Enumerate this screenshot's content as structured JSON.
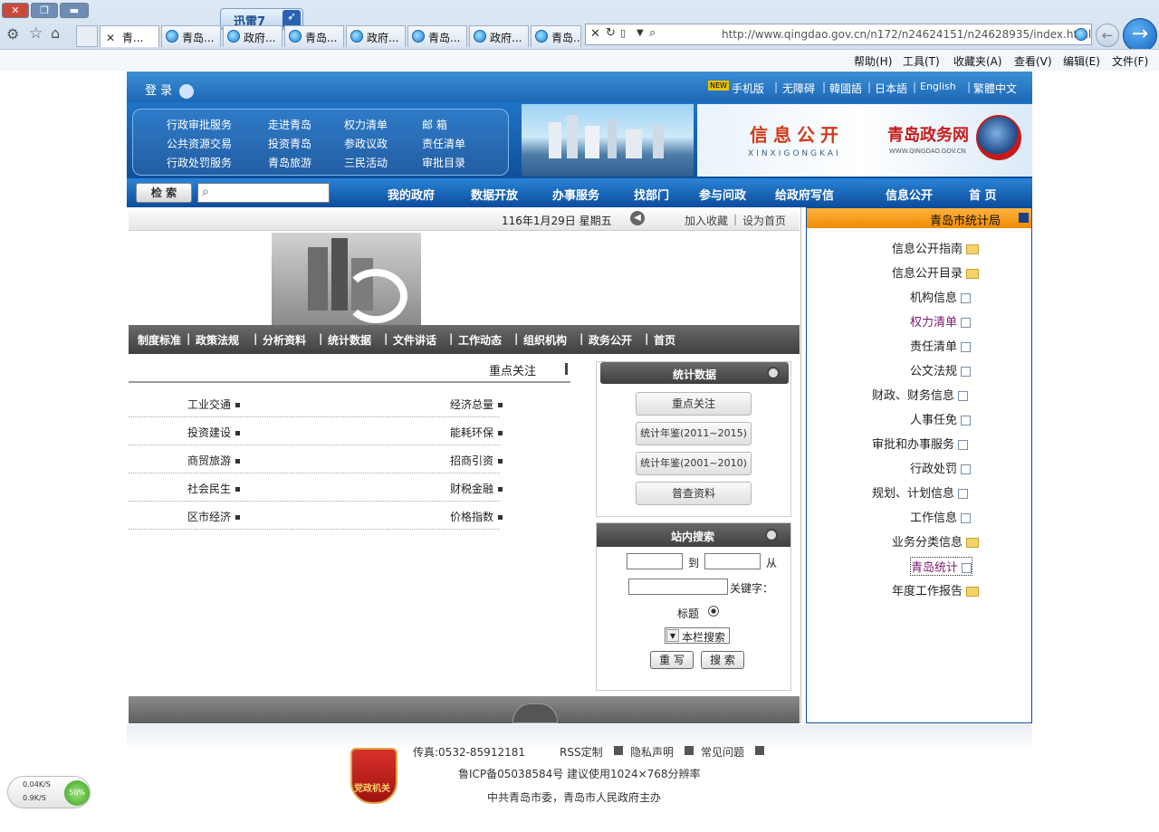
{
  "browser": {
    "url": "http://www.qingdao.gov.cn/n172/n24624151/n24628935/index.html",
    "tabs": [
      "青岛...",
      "政府...",
      "青岛...",
      "政府...",
      "青岛...",
      "政府...",
      "青岛...",
      "青..."
    ],
    "menu": [
      "文件(F)",
      "编辑(E)",
      "查看(V)",
      "收藏夹(A)",
      "工具(T)",
      "帮助(H)"
    ],
    "thunder_label": "迅雷7",
    "net_speed": {
      "percent": "50%",
      "up": "0.04K/S",
      "down": "0.9K/S"
    }
  },
  "topstrip": {
    "login": "登 录",
    "links": [
      "繁體中文",
      "English",
      "日本語",
      "韓國語",
      "无障碍",
      "手机版"
    ],
    "new_badge": "NEW"
  },
  "banner": {
    "logo_text": "青岛政务网",
    "logo_sub": "WWW.QINGDAO.GOV.CN",
    "section_title": "信息公开",
    "section_sub": "XINXIGONGKAI",
    "links": [
      [
        "行政审批服务",
        "走进青岛",
        "权力清单",
        "邮 箱"
      ],
      [
        "公共资源交易",
        "投资青岛",
        "参政议政",
        "责任清单"
      ],
      [
        "行政处罚服务",
        "青岛旅游",
        "三民活动",
        "审批目录"
      ]
    ]
  },
  "nav": {
    "items": [
      "首 页",
      "信息公开",
      "给政府写信",
      "参与问政",
      "找部门",
      "办事服务",
      "数据开放",
      "我的政府"
    ],
    "search_button": "检 索"
  },
  "right": {
    "title": "青岛市统计局",
    "tree": [
      "信息公开指南",
      "信息公开目录",
      "机构信息",
      "权力清单",
      "责任清单",
      "公文法规",
      "财政、财务信息",
      "人事任免",
      "审批和办事服务",
      "行政处罚",
      "规划、计划信息",
      "工作信息",
      "业务分类信息",
      "青岛统计",
      "年度工作报告"
    ]
  },
  "left": {
    "sethome": "设为首页",
    "favorite": "加入收藏",
    "date": "116年1月29日 星期五",
    "subnav": [
      "首页",
      "政务公开",
      "组织机构",
      "工作动态",
      "文件讲话",
      "统计数据",
      "分析资料",
      "政策法规",
      "制度标准"
    ],
    "focus_title": "重点关注",
    "focus_items": [
      [
        "经济总量",
        "工业交通"
      ],
      [
        "能耗环保",
        "投资建设"
      ],
      [
        "招商引资",
        "商贸旅游"
      ],
      [
        "财税金融",
        "社会民生"
      ],
      [
        "价格指数",
        "区市经济"
      ]
    ],
    "stats_title": "统计数据",
    "stats_buttons": [
      "重点关注",
      "统计年鉴(2011~2015)",
      "统计年鉴(2001~2010)",
      "普查资料"
    ],
    "search_title": "站内搜索",
    "search": {
      "from": "从",
      "to": "到",
      "keyword": "关键字：",
      "radio": "标题",
      "select": "本栏搜索",
      "submit": "搜 索",
      "reset": "重 写"
    }
  },
  "footer": {
    "links": [
      "常见问题",
      "隐私声明",
      "RSS定制",
      "传真:0532-85912181"
    ],
    "line2": "鲁ICP备05038584号  建议使用1024×768分辨率",
    "line3": "中共青岛市委，青岛市人民政府主办",
    "badge": "党政机关"
  },
  "colors": {
    "brand_blue": "#1d67b5",
    "orange": "#f08a00",
    "gray_bar": "#4a4a4a"
  }
}
